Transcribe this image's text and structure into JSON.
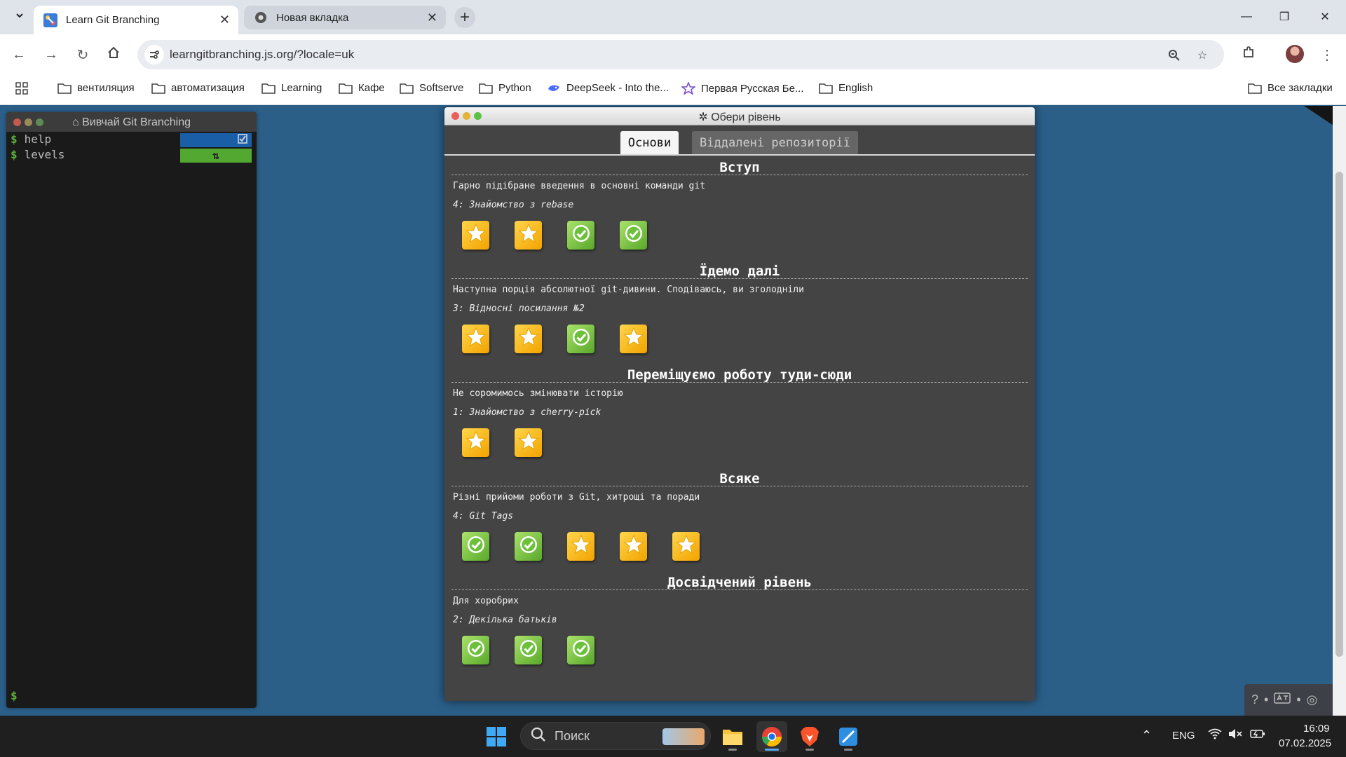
{
  "browser": {
    "tabs": [
      {
        "title": "Learn Git Branching",
        "active": true
      },
      {
        "title": "Новая вкладка",
        "active": false
      }
    ],
    "address": "learngitbranching.js.org/?locale=uk",
    "bookmarks": [
      "вентиляция",
      "автоматизация",
      "Learning",
      "Кафе",
      "Softserve",
      "Python",
      "DeepSeek - Into the...",
      "Первая Русская Бе...",
      "English"
    ],
    "all_bookmarks_label": "Все закладки"
  },
  "terminal": {
    "title": "Вивчай Git Branching",
    "lines": [
      {
        "prompt": "$",
        "command": "help"
      },
      {
        "prompt": "$",
        "command": "levels"
      }
    ],
    "bottom_prompt": "$",
    "colors": {
      "help_badge": "#1b5ea8",
      "levels_badge": "#52a830"
    }
  },
  "modal": {
    "title": "Обери рівень",
    "tabs": {
      "main": "Основи",
      "remote": "Віддалені репозиторії"
    },
    "sections": [
      {
        "title": "Вступ",
        "description": "Гарно підібране введення в основні команди git",
        "current": "4: Знайомство з rebase",
        "levels": [
          "star",
          "star",
          "check",
          "check"
        ]
      },
      {
        "title": "Їдемо далі",
        "description": "Наступна порція абсолютної git-дивини. Сподіваюсь, ви зголодніли",
        "current": "3: Відносні посилання №2",
        "levels": [
          "star",
          "star",
          "check",
          "star"
        ]
      },
      {
        "title": "Переміщуємо роботу туди-сюди",
        "description": "Не соромимось змінювати історію",
        "current": "1: Знайомство з cherry-pick",
        "levels": [
          "star",
          "star"
        ]
      },
      {
        "title": "Всяке",
        "description": "Різні прийоми роботи з Git, хитрощі та поради",
        "current": "4: Git Tags",
        "levels": [
          "check",
          "check",
          "star",
          "star",
          "star"
        ]
      },
      {
        "title": "Досвідчений рівень",
        "description": "Для хоробрих",
        "current": "2: Декілька батьків",
        "levels": [
          "check",
          "check",
          "check"
        ]
      }
    ]
  },
  "taskbar": {
    "search_placeholder": "Поиск",
    "lang": "ENG",
    "time": "16:09",
    "date": "07.02.2025"
  }
}
